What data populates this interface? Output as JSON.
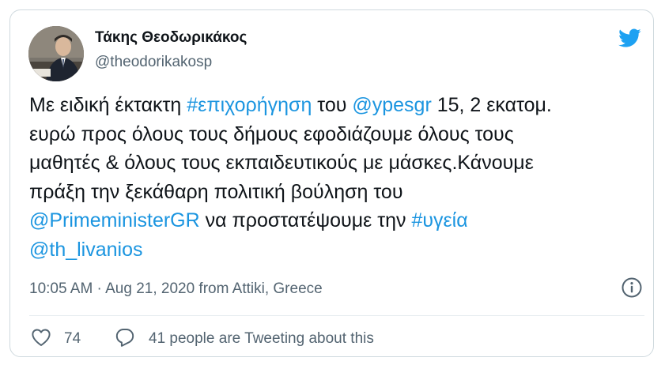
{
  "tweet": {
    "author_name": "Τάκης Θεοδωρικάκος",
    "author_handle": "@theodorikakosp",
    "lines": [
      [
        {
          "text": "Με ειδική έκτακτη ",
          "link": false
        },
        {
          "text": "#επιχορήγηση",
          "link": true
        },
        {
          "text": " του ",
          "link": false
        },
        {
          "text": "@ypesgr",
          "link": true
        },
        {
          "text": " 15, 2 εκατομ.",
          "link": false
        }
      ],
      [
        {
          "text": "ευρώ προς όλους τους δήμους εφοδιάζουμε όλους τους",
          "link": false
        }
      ],
      [
        {
          "text": "μαθητές & όλους τους εκπαιδευτικούς με μάσκες.Κάνουμε",
          "link": false
        }
      ],
      [
        {
          "text": "πράξη την ξεκάθαρη πολιτική βούληση του",
          "link": false
        }
      ],
      [
        {
          "text": "@PrimeministerGR",
          "link": true
        },
        {
          "text": " να προστατέψουμε την ",
          "link": false
        },
        {
          "text": "#υγεία",
          "link": true
        }
      ],
      [
        {
          "text": "@th_livanios",
          "link": true
        }
      ]
    ],
    "timestamp": "10:05 AM · Aug 21, 2020 from Attiki, Greece",
    "like_count": "74",
    "reply_text": "41 people are Tweeting about this"
  },
  "colors": {
    "link": "#1b95e0",
    "twitter_blue": "#1da1f2",
    "text_primary": "#0f1419",
    "text_secondary": "#536471",
    "border": "#cfd9de"
  },
  "icons": {
    "brand": "twitter-bird-icon",
    "info": "info-icon",
    "like": "heart-icon",
    "reply": "speech-bubble-icon"
  }
}
